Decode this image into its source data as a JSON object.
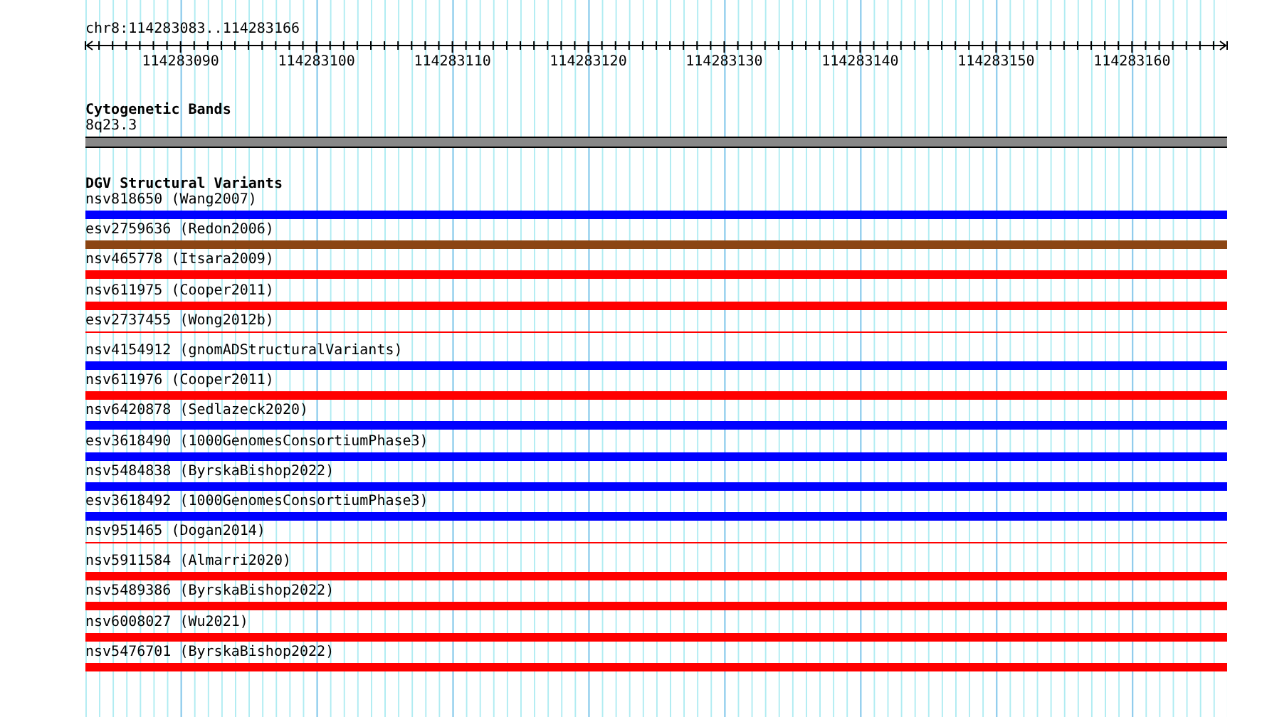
{
  "location": "chr8:114283083..114283166",
  "ruler": {
    "labels": [
      "114283090",
      "114283100",
      "114283110",
      "114283120",
      "114283130",
      "114283140",
      "114283150",
      "114283160"
    ]
  },
  "cytoband_track": {
    "title": "Cytogenetic Bands",
    "band": "8q23.3"
  },
  "variant_track": {
    "title": "DGV Structural Variants",
    "features": [
      {
        "label": "nsv818650 (Wang2007)",
        "kind": "thick",
        "color": "#0000ff"
      },
      {
        "label": "esv2759636 (Redon2006)",
        "kind": "thick",
        "color": "#8b4513"
      },
      {
        "label": "nsv465778 (Itsara2009)",
        "kind": "thick",
        "color": "#ff0000"
      },
      {
        "label": "nsv611975 (Cooper2011)",
        "kind": "thick",
        "color": "#ff0000"
      },
      {
        "label": "esv2737455 (Wong2012b)",
        "kind": "thin",
        "color": "#ff0000"
      },
      {
        "label": "nsv4154912 (gnomADStructuralVariants)",
        "kind": "thick",
        "color": "#0000ff"
      },
      {
        "label": "nsv611976 (Cooper2011)",
        "kind": "thick",
        "color": "#ff0000"
      },
      {
        "label": "nsv6420878 (Sedlazeck2020)",
        "kind": "thick",
        "color": "#0000ff"
      },
      {
        "label": "esv3618490 (1000GenomesConsortiumPhase3)",
        "kind": "thick",
        "color": "#0000ff"
      },
      {
        "label": "nsv5484838 (ByrskaBishop2022)",
        "kind": "thick",
        "color": "#0000ff"
      },
      {
        "label": "esv3618492 (1000GenomesConsortiumPhase3)",
        "kind": "thick",
        "color": "#0000ff"
      },
      {
        "label": "nsv951465 (Dogan2014)",
        "kind": "thin",
        "color": "#ff0000"
      },
      {
        "label": "nsv5911584 (Almarri2020)",
        "kind": "thick",
        "color": "#ff0000"
      },
      {
        "label": "nsv5489386 (ByrskaBishop2022)",
        "kind": "thick",
        "color": "#ff0000"
      },
      {
        "label": "nsv6008027 (Wu2021)",
        "kind": "thick",
        "color": "#ff0000"
      },
      {
        "label": "nsv5476701 (ByrskaBishop2022)",
        "kind": "thick",
        "color": "#ff0000"
      }
    ]
  }
}
